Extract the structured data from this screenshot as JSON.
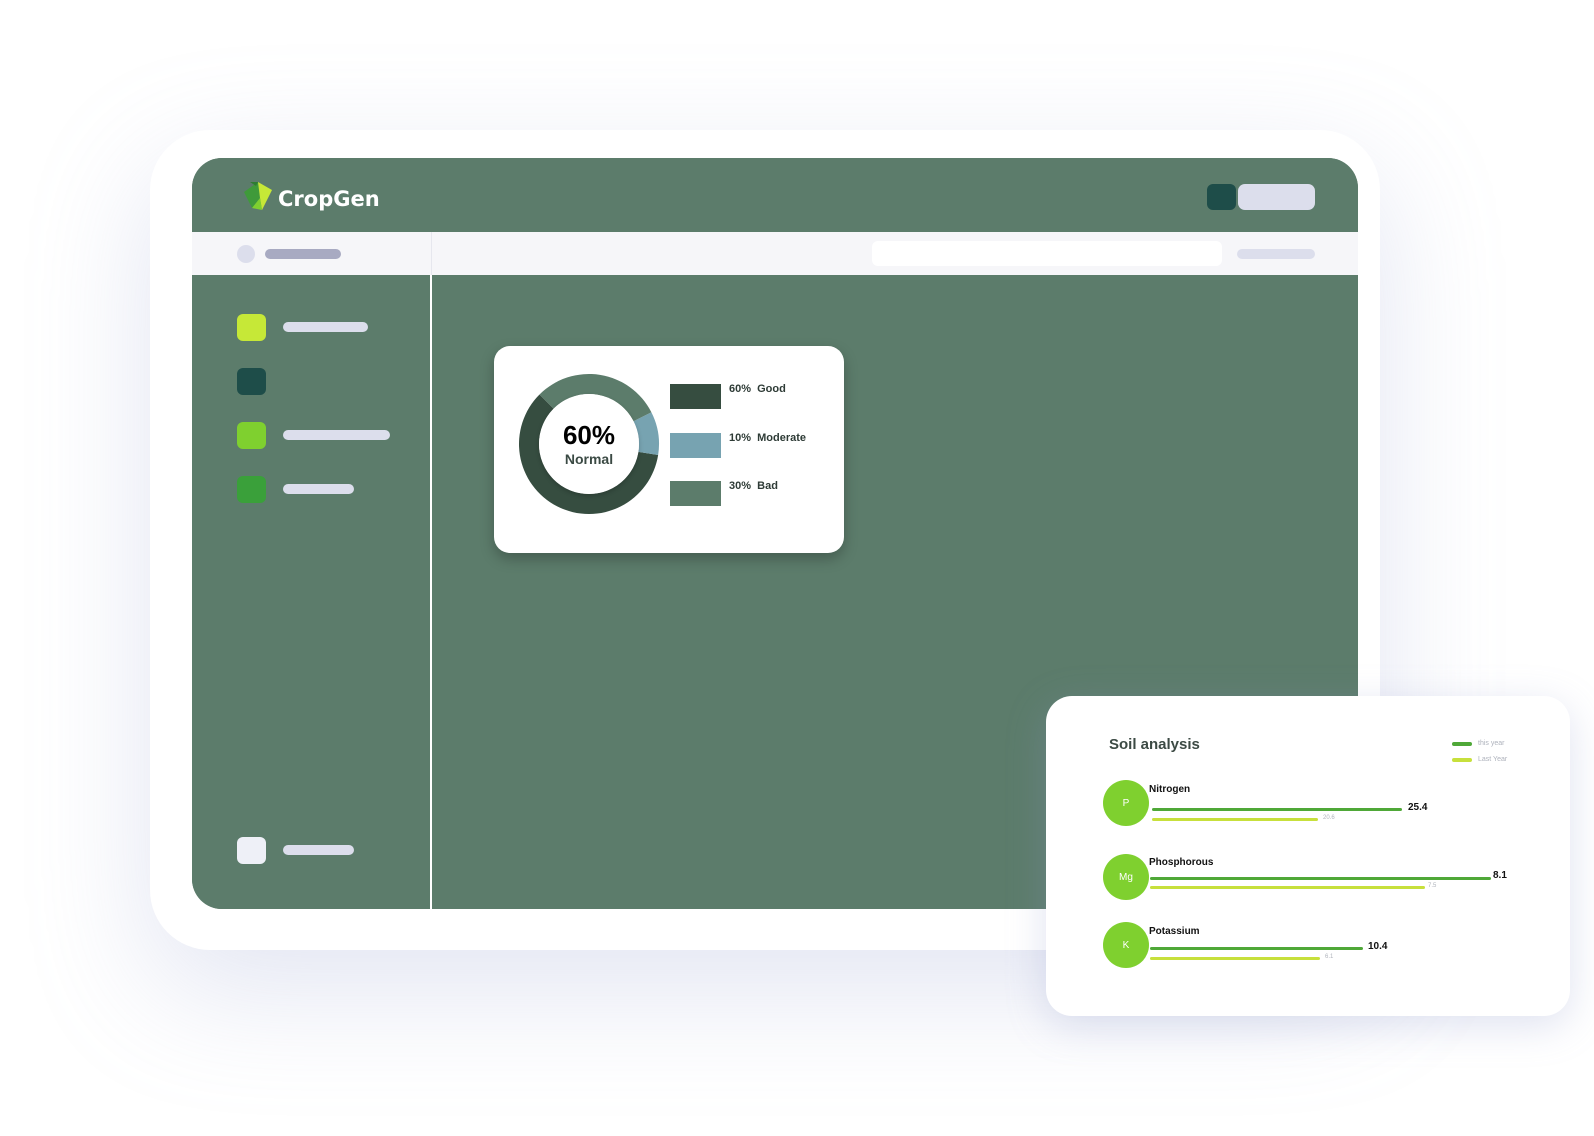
{
  "brand": {
    "name": "CropGen",
    "logo_icon": "leaf-logo-icon"
  },
  "colors": {
    "app_bg": "#5c7c6b",
    "subbar_bg": "#f6f6f9",
    "good": "#364d40",
    "moderate": "#77a3b1",
    "bad": "#5c7c6b",
    "this_year": "#4fa838",
    "last_year": "#c7e03c",
    "nutrient_circle": "#7fd02f"
  },
  "sidebar": {
    "items": [
      {
        "icon": "nav-square-lime",
        "color": "#c6e837"
      },
      {
        "icon": "nav-square-dark",
        "color": "#1e4d49"
      },
      {
        "icon": "nav-square-green",
        "color": "#7fd02f"
      },
      {
        "icon": "nav-square-mid-green",
        "color": "#3aa03a"
      }
    ],
    "footer_item": {
      "icon": "nav-square-light",
      "color": "#eef0f7"
    }
  },
  "donut_card": {
    "center_value": "60%",
    "center_label": "Normal",
    "legend": [
      {
        "text": "60%  Good",
        "color": "#364d40"
      },
      {
        "text": "10%  Moderate",
        "color": "#77a3b1"
      },
      {
        "text": "30%  Bad",
        "color": "#5c7c6b"
      }
    ]
  },
  "soil_card": {
    "title": "Soil analysis",
    "legend": {
      "this_year": "this year",
      "last_year": "Last Year"
    },
    "rows": [
      {
        "symbol": "P",
        "name": "Nitrogen",
        "this_value": "25.4",
        "last_value": "20.6"
      },
      {
        "symbol": "Mg",
        "name": "Phosphorous",
        "this_value": "8.1",
        "last_value": "7.5"
      },
      {
        "symbol": "K",
        "name": "Potassium",
        "this_value": "10.4",
        "last_value": "6.1"
      }
    ]
  },
  "chart_data": {
    "type": "pie",
    "title": "",
    "categories": [
      "Good",
      "Moderate",
      "Bad"
    ],
    "values": [
      60,
      10,
      30
    ],
    "center_text": "60% Normal",
    "legend_placement": "right"
  }
}
